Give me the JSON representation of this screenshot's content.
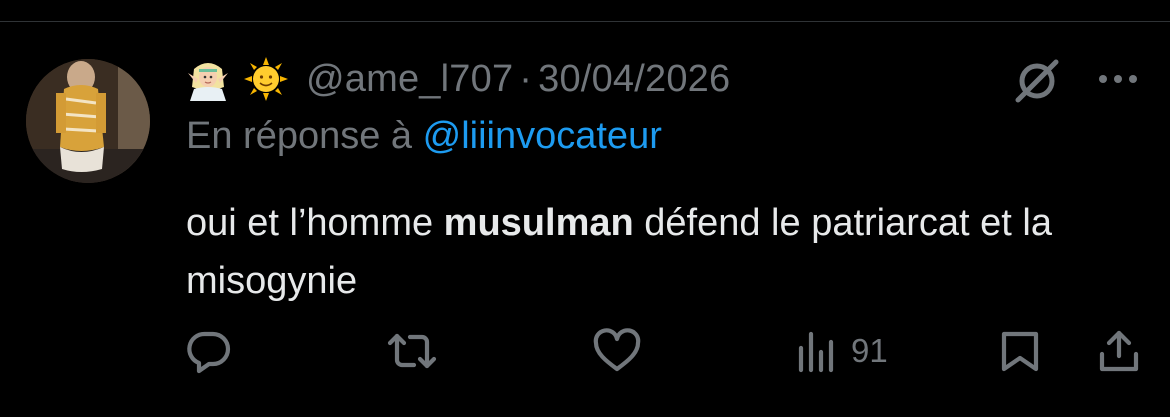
{
  "post": {
    "author_emojis": [
      "woman-elf-emoji",
      "sun-with-face-emoji"
    ],
    "handle": "@ame_l707",
    "separator": "·",
    "date": "30/04/2026",
    "reply_prefix": "En réponse à",
    "reply_mention": "@liiinvocateur",
    "text_part1": "oui et l’homme ",
    "text_bold": "musulman",
    "text_part2": " défend le patriarcat et la misogynie"
  },
  "actions": {
    "reply_icon": "reply-icon",
    "repost_icon": "repost-icon",
    "like_icon": "like-icon",
    "views_icon": "views-icon",
    "views_count": "91",
    "bookmark_icon": "bookmark-icon",
    "share_icon": "share-icon"
  },
  "colors": {
    "background": "#000000",
    "text": "#e7e9ea",
    "muted": "#71767b",
    "link": "#1d9bf0"
  }
}
